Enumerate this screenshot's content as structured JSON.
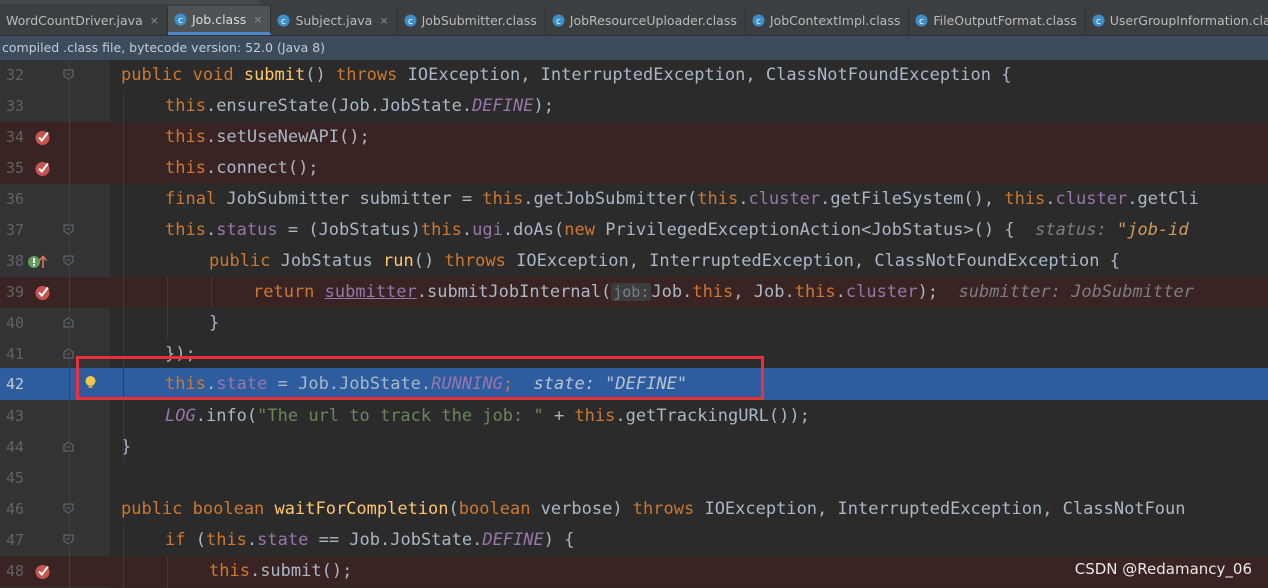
{
  "tabs": [
    {
      "label": "WordCountDriver.java",
      "icon": "java-file-icon",
      "active": false
    },
    {
      "label": "Job.class",
      "icon": "class-file-icon",
      "active": true
    },
    {
      "label": "Subject.java",
      "icon": "java-file-icon",
      "active": false
    },
    {
      "label": "JobSubmitter.class",
      "icon": "class-file-icon",
      "active": false
    },
    {
      "label": "JobResourceUploader.class",
      "icon": "class-file-icon",
      "active": false
    },
    {
      "label": "JobContextImpl.class",
      "icon": "class-file-icon",
      "active": false
    },
    {
      "label": "FileOutputFormat.class",
      "icon": "class-file-icon",
      "active": false
    },
    {
      "label": "UserGroupInformation.cla",
      "icon": "class-file-icon",
      "active": false
    }
  ],
  "close_glyph": "×",
  "infobar": {
    "text": "compiled .class file, bytecode version: 52.0 (Java 8)"
  },
  "colors": {
    "keyword": "#cc7832",
    "function": "#ffc66d",
    "field": "#9876aa",
    "string": "#6a8759",
    "exec_line": "#2d5d9f",
    "breakpoint": "#c75450",
    "highlight_box": "#e8303a"
  },
  "lines": [
    {
      "num": "32",
      "t": {
        "a": "public void ",
        "b": "submit",
        "c": "() ",
        "d": "throws ",
        "e": "IOException, InterruptedException, ClassNotFoundException {"
      }
    },
    {
      "num": "33",
      "t": {
        "a": "this",
        "b": ".ensureState(Job.JobState.",
        "c": "DEFINE",
        "d": ");"
      }
    },
    {
      "num": "34",
      "t": {
        "a": "this",
        "b": ".setUseNewAPI();"
      }
    },
    {
      "num": "35",
      "t": {
        "a": "this",
        "b": ".connect();"
      }
    },
    {
      "num": "36",
      "t": {
        "a": "final ",
        "b": "JobSubmitter submitter = ",
        "c": "this",
        "d": ".getJobSubmitter(",
        "e": "this",
        "f": ".",
        "g": "cluster",
        "h": ".getFileSystem(), ",
        "i": "this",
        "j": ".",
        "k": "cluster",
        "l": ".getCli"
      }
    },
    {
      "num": "37",
      "t": {
        "a": "this",
        "b": ".",
        "c": "status",
        "d": " = (JobStatus)",
        "e": "this",
        "f": ".",
        "g": "ugi",
        "h": ".doAs(",
        "i": "new ",
        "j": "PrivilegedExceptionAction<JobStatus>() {",
        "k": "  status: ",
        "l": "\"job-id"
      }
    },
    {
      "num": "38",
      "t": {
        "a": "public ",
        "b": "JobStatus ",
        "c": "run",
        "d": "() ",
        "e": "throws ",
        "f": "IOException, InterruptedException, ClassNotFoundException {"
      }
    },
    {
      "num": "39",
      "t": {
        "a": "return ",
        "b": "submitter",
        "c": ".submitJobInternal(",
        "d": "job:",
        "e": "Job.",
        "f": "this",
        "g": ", Job.",
        "h": "this",
        "i": ".",
        "j": "cluster",
        "k": ");",
        "l": "  submitter: JobSubmitter"
      }
    },
    {
      "num": "40",
      "t": {
        "a": "}"
      }
    },
    {
      "num": "41",
      "t": {
        "a": "});"
      }
    },
    {
      "num": "42",
      "t": {
        "a": "this",
        "b": ".",
        "c": "state",
        "d": " = Job.JobState.",
        "e": "RUNNING",
        "f": ";",
        "g": "  state: \"DEFINE\""
      }
    },
    {
      "num": "43",
      "t": {
        "a": "LOG",
        "b": ".info(",
        "c": "\"The url to track the job: \"",
        "d": " + ",
        "e": "this",
        "f": ".getTrackingURL());"
      }
    },
    {
      "num": "44",
      "t": {
        "a": "}"
      }
    },
    {
      "num": "45",
      "t": {}
    },
    {
      "num": "46",
      "t": {
        "a": "public boolean ",
        "b": "waitForCompletion",
        "c": "(",
        "d": "boolean ",
        "e": "verbose) ",
        "f": "throws ",
        "g": "IOException, InterruptedException, ClassNotFoun"
      }
    },
    {
      "num": "47",
      "t": {
        "a": "if ",
        "b": "(",
        "c": "this",
        "d": ".",
        "e": "state",
        "f": " == Job.JobState.",
        "g": "DEFINE",
        "h": ") {"
      }
    },
    {
      "num": "48",
      "t": {
        "a": "this",
        "b": ".submit();"
      }
    }
  ],
  "watermark": "CSDN @Redamancy_06"
}
